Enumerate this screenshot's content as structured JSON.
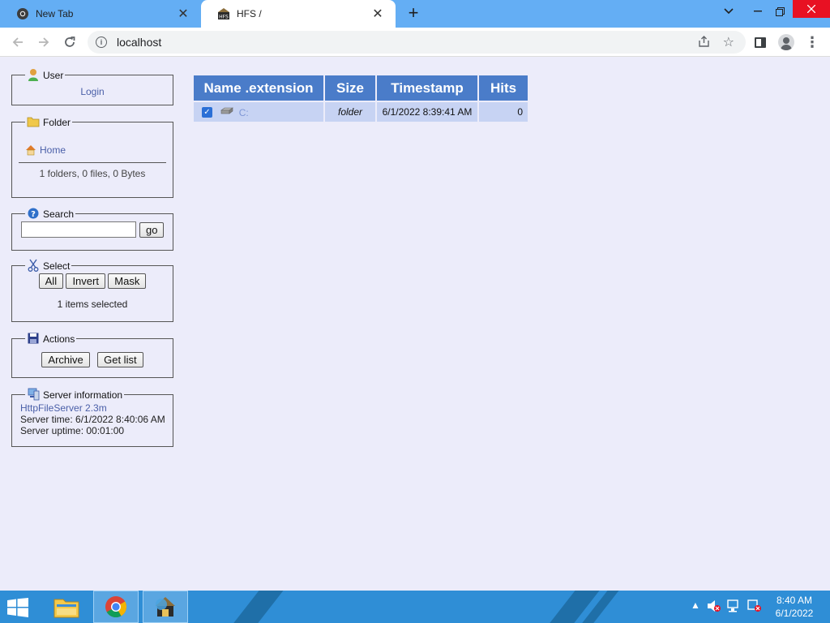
{
  "browser": {
    "tabs": [
      {
        "title": "New Tab",
        "active": false
      },
      {
        "title": "HFS /",
        "active": true
      }
    ],
    "address": "localhost"
  },
  "sidebar": {
    "user": {
      "legend": "User",
      "login": "Login"
    },
    "folder": {
      "legend": "Folder",
      "home": "Home",
      "summary": "1 folders, 0 files, 0 Bytes"
    },
    "search": {
      "legend": "Search",
      "value": "",
      "go": "go"
    },
    "select": {
      "legend": "Select",
      "all": "All",
      "invert": "Invert",
      "mask": "Mask",
      "status": "1 items selected"
    },
    "actions": {
      "legend": "Actions",
      "archive": "Archive",
      "get_list": "Get list"
    },
    "server": {
      "legend": "Server information",
      "link": "HttpFileServer 2.3m",
      "time": "Server time: 6/1/2022 8:40:06 AM",
      "uptime": "Server uptime: 00:01:00"
    }
  },
  "file_table": {
    "headers": {
      "name": "Name .extension",
      "size": "Size",
      "timestamp": "Timestamp",
      "hits": "Hits"
    },
    "rows": [
      {
        "name": "C:",
        "size": "folder",
        "timestamp": "6/1/2022 8:39:41 AM",
        "hits": "0",
        "checked": true
      }
    ]
  },
  "taskbar": {
    "time": "8:40 AM",
    "date": "6/1/2022"
  },
  "colors": {
    "tab_strip": "#64aef4",
    "page_bg": "#ececfa",
    "table_header": "#4a7cc9",
    "table_row": "#c7d3f3",
    "taskbar": "#2f8ed6"
  }
}
